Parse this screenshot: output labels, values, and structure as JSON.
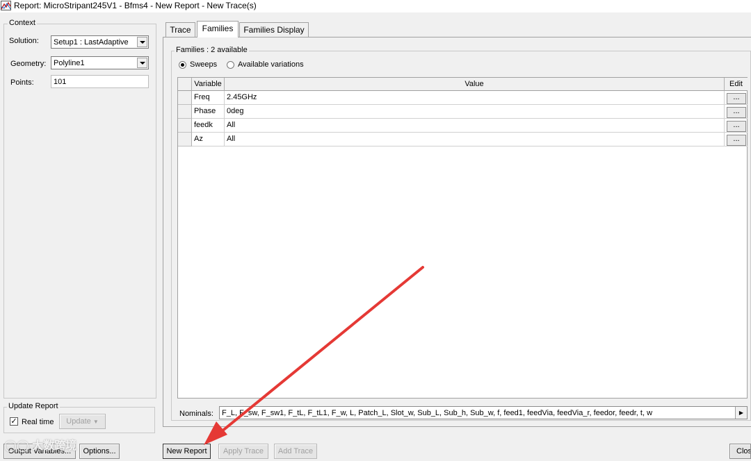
{
  "window": {
    "title": "Report: MicroStripant245V1 - Bfms4 - New Report - New Trace(s)"
  },
  "context": {
    "legend": "Context",
    "solution_label": "Solution:",
    "solution_value": "Setup1 : LastAdaptive",
    "geometry_label": "Geometry:",
    "geometry_value": "Polyline1",
    "points_label": "Points:",
    "points_value": "101"
  },
  "update_report": {
    "legend": "Update Report",
    "realtime_label": "Real time",
    "realtime_checked": true,
    "update_label": "Update"
  },
  "tabs": [
    {
      "label": "Trace",
      "active": false
    },
    {
      "label": "Families",
      "active": true
    },
    {
      "label": "Families Display",
      "active": false
    }
  ],
  "families": {
    "legend": "Families : 2 available",
    "radio_sweeps": "Sweeps",
    "radio_available": "Available variations",
    "columns": [
      "Variable",
      "Value",
      "Edit"
    ],
    "rows": [
      {
        "variable": "Freq",
        "value": "2.45GHz",
        "edit": "..."
      },
      {
        "variable": "Phase",
        "value": "0deg",
        "edit": "..."
      },
      {
        "variable": "feedk",
        "value": "All",
        "edit": "..."
      },
      {
        "variable": "Az",
        "value": "All",
        "edit": "..."
      }
    ],
    "nominals_label": "Nominals:",
    "nominals_value": "F_L, F_sw, F_sw1, F_tL, F_tL1, F_w, L, Patch_L, Slot_w, Sub_L, Sub_h, Sub_w, f, feed1, feedVia, feedVia_r, feedor, feedr, t, w"
  },
  "buttons": {
    "output_variables": "Output Variables...",
    "options": "Options...",
    "new_report": "New Report",
    "apply_trace": "Apply Trace",
    "add_trace": "Add Trace",
    "close": "Close"
  },
  "watermark": "大数跨境",
  "colors": {
    "arrow": "#e53935",
    "window_bg": "#f0f0f0"
  }
}
